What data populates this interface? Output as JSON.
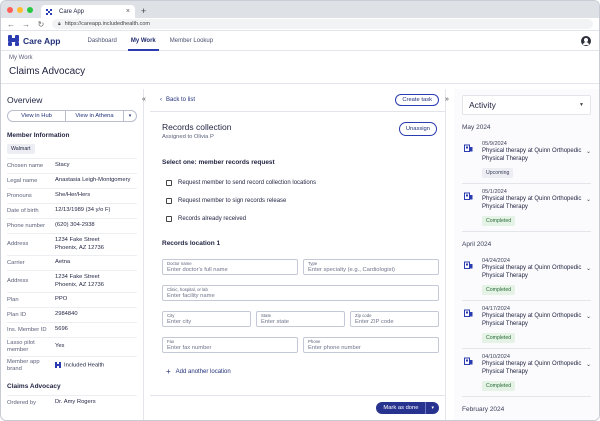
{
  "browser": {
    "tab_title": "Care App",
    "url": "https://careapp.includedhealth.com",
    "new_tab": "+",
    "close": "×",
    "dot_colors": [
      "#ff5f57",
      "#febc2e",
      "#28c840"
    ]
  },
  "app": {
    "logo_text": "Care App",
    "nav": [
      "Dashboard",
      "My Work",
      "Member Lookup"
    ],
    "active_nav": "My Work",
    "accent": "#2b3bb0"
  },
  "page": {
    "breadcrumb": "My Work",
    "title": "Claims Advocacy"
  },
  "overview": {
    "title": "Overview",
    "view_hub": "View in Hub",
    "view_athena": "View in Athena",
    "dropdown": "▾",
    "member_info_title": "Member Information",
    "employer_chip": "Walmart",
    "fields": [
      {
        "label": "Chosen name",
        "value": "Stacy"
      },
      {
        "label": "Legal name",
        "value": "Anastasia Leigh-Montgomery"
      },
      {
        "label": "Pronouns",
        "value": "She/Her/Hers"
      },
      {
        "label": "Date of birth",
        "value": "12/13/1989 (34 y/o F)"
      },
      {
        "label": "Phone number",
        "value": "(620) 304-2938"
      },
      {
        "label": "Address",
        "value_lines": [
          "1234 Fake Street",
          "Phoenix, AZ 12736"
        ]
      },
      {
        "label": "Carrier",
        "value": "Aetna"
      },
      {
        "label": "Address",
        "value_lines": [
          "1234 Fake Street",
          "Phoenix, AZ 12736"
        ]
      },
      {
        "label": "Plan",
        "value": "PPO"
      },
      {
        "label": "Plan ID",
        "value": "2984840"
      },
      {
        "label": "Ins. Member ID",
        "value": "5696"
      },
      {
        "label": "Lasso pilot member",
        "value": "Yes"
      },
      {
        "label": "Member app brand",
        "value": "Included Health"
      }
    ],
    "claims_title": "Claims Advocacy",
    "ordered_by_label": "Ordered by",
    "ordered_by_value": "Dr. Amy Rogers"
  },
  "task": {
    "back": "Back to list",
    "create": "Create task",
    "title": "Records collection",
    "assigned": "Assigned to Olivia P",
    "unassign": "Unassign",
    "select_heading": "Select one: member records request",
    "options": [
      "Request member to send record collection locations",
      "Request member to sign records release",
      "Records already received"
    ],
    "location_heading": "Records location 1",
    "fields": {
      "doctor": {
        "label": "Doctor name",
        "placeholder": "Enter doctor's full name"
      },
      "type": {
        "label": "Type",
        "placeholder": "Enter specialty (e.g., Cardiologist)"
      },
      "clinic": {
        "label": "Clinic, hospital, or lab",
        "placeholder": "Enter facility name"
      },
      "city": {
        "label": "City",
        "placeholder": "Enter city"
      },
      "state": {
        "label": "State",
        "placeholder": "Enter state"
      },
      "zip": {
        "label": "Zip code",
        "placeholder": "Enter ZIP code"
      },
      "fax": {
        "label": "Fax",
        "placeholder": "Enter fax number"
      },
      "phone": {
        "label": "Phone",
        "placeholder": "Enter phone number"
      }
    },
    "add_location": "Add another location",
    "mark_done": "Mark as done",
    "caret": "▾"
  },
  "activity": {
    "title": "Activity",
    "groups": [
      {
        "month": "May 2024",
        "items": [
          {
            "date": "05/9/2024",
            "title": "Physical therapy at Quinn Orthopedic Physical Therapy",
            "status": "Upcoming"
          },
          {
            "date": "05/1/2024",
            "title": "Physical therapy at Quinn Orthopedic Physical Therapy",
            "status": "Completed"
          }
        ]
      },
      {
        "month": "April 2024",
        "items": [
          {
            "date": "04/24/2024",
            "title": "Physical therapy at Quinn Orthopedic Physical Therapy",
            "status": "Completed"
          },
          {
            "date": "04/17/2024",
            "title": "Physical therapy at Quinn Orthopedic Physical Therapy",
            "status": "Completed"
          },
          {
            "date": "04/10/2024",
            "title": "Physical therapy at Quinn Orthopedic Physical Therapy",
            "status": "Completed"
          }
        ]
      },
      {
        "month": "February 2024",
        "items": []
      }
    ]
  }
}
